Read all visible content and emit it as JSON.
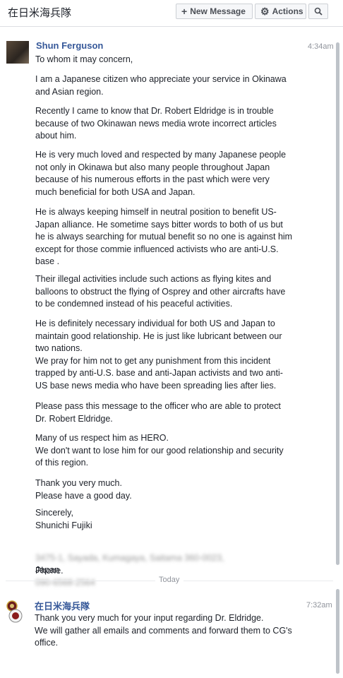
{
  "header": {
    "title": "在日米海兵隊",
    "new_message_label": "New Message",
    "actions_label": "Actions",
    "new_message_icon": "plus-icon",
    "actions_icon": "gear-icon",
    "search_icon": "search-icon"
  },
  "messages": [
    {
      "sender": "Shun Ferguson",
      "time": "4:34am",
      "paragraphs": [
        "To whom it may concern,",
        "I am a Japanese citizen who appreciate your service in Okinawa\nand Asian region.",
        "Recently I came to know that Dr. Robert Eldridge is in trouble\nbecause of two Okinawan news media wrote incorrect articles\nabout him.",
        "He is very much loved and respected by many Japanese people\nnot only in Okinawa but also many people throughout Japan\nbecause of his numerous efforts in the past which were very\nmuch beneficial for both USA and Japan.",
        "He is always keeping himself in neutral position to benefit US-\nJapan alliance. He sometime says bitter words to both of us but\nhe is always searching for mutual benefit so no one is against him\nexcept for those commie influenced activists who are anti-U.S.\nbase .",
        "Their illegal activities include such actions as flying kites and\nballoons to obstruct the flying of Osprey and other aircrafts have\nto be condemned instead of his peaceful activities.",
        "He is definitely necessary individual for both US and Japan to\nmaintain good relationship. He is just like lubricant between our\ntwo nations.\nWe pray for him not to get any punishment from this incident\ntrapped by anti-U.S. base and anti-Japan activists and two anti-\nUS base news media who have been spreading lies after lies.",
        "Please pass this message to the officer who are able to protect\nDr. Robert Eldridge.",
        "Many of us respect him as HERO.\nWe don't want to lose him for our good relationship and security\nof this region.",
        "Thank you very much.\nPlease have a good day.",
        "Sincerely,\nShunichi Fujiki"
      ],
      "address_blurred": "3475-1, Sayada, Kumagaya, Saitama 360-0023,",
      "address_country": "Japan",
      "phone_label": "Phone.",
      "phone_blurred": "090-6568-2564"
    },
    {
      "sender": "在日米海兵隊",
      "time": "7:32am",
      "text": "Thank you very much for your input regarding Dr. Eldridge.\nWe will gather all emails and comments and forward them to CG's\noffice."
    }
  ],
  "divider_label": "Today"
}
